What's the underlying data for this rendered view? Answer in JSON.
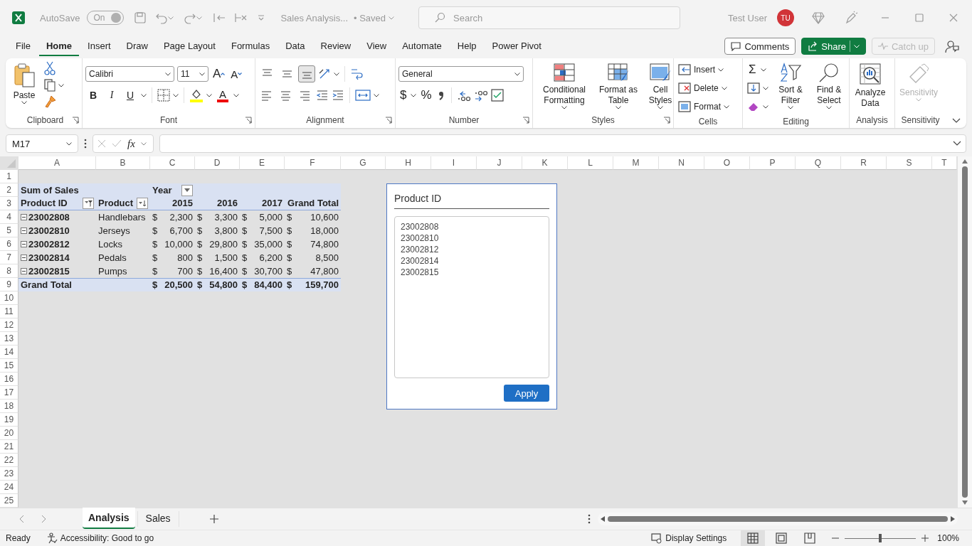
{
  "title_bar": {
    "autosave": {
      "label": "AutoSave",
      "state": "On",
      "on": true
    },
    "file_name": "Sales Analysis...",
    "save_status": "• Saved",
    "search": {
      "placeholder": "Search"
    },
    "user": {
      "name": "Test User",
      "initials": "TU"
    }
  },
  "menu": {
    "tabs": [
      {
        "label": "File",
        "selected": false
      },
      {
        "label": "Home",
        "selected": true
      },
      {
        "label": "Insert",
        "selected": false
      },
      {
        "label": "Draw",
        "selected": false
      },
      {
        "label": "Page Layout",
        "selected": false
      },
      {
        "label": "Formulas",
        "selected": false
      },
      {
        "label": "Data",
        "selected": false
      },
      {
        "label": "Review",
        "selected": false
      },
      {
        "label": "View",
        "selected": false
      },
      {
        "label": "Automate",
        "selected": false
      },
      {
        "label": "Help",
        "selected": false
      },
      {
        "label": "Power Pivot",
        "selected": false
      }
    ],
    "actions": [
      {
        "kind": "comments",
        "label": "Comments",
        "disabled": false
      },
      {
        "kind": "share",
        "label": "Share",
        "disabled": false
      },
      {
        "kind": "catchup",
        "label": "Catch up",
        "disabled": true
      }
    ]
  },
  "ribbon": {
    "clipboard": {
      "label": "Clipboard",
      "paste": "Paste"
    },
    "font": {
      "label": "Font",
      "font_name": "Calibri",
      "font_size": "11",
      "grow": "A",
      "shrink": "A",
      "styles": [
        "B",
        "I",
        "U"
      ],
      "font_color_letter": "A"
    },
    "alignment": {
      "label": "Alignment",
      "vertical": [
        {
          "selected": false
        },
        {
          "selected": false
        },
        {
          "selected": true
        }
      ]
    },
    "number": {
      "label": "Number",
      "format": "General",
      "currency": "$",
      "percent": "%"
    },
    "styles": {
      "label": "Styles",
      "buttons": [
        "Conditional Formatting",
        "Format as Table",
        "Cell Styles"
      ]
    },
    "cells": {
      "label": "Cells",
      "buttons": [
        "Insert",
        "Delete",
        "Format"
      ]
    },
    "editing": {
      "label": "Editing",
      "autosum": "Σ",
      "buttons": [
        "Sort & Filter",
        "Find & Select"
      ]
    },
    "analysis": {
      "label": "Analysis",
      "button": "Analyze Data"
    },
    "sensitivity": {
      "label": "Sensitivity",
      "button": "Sensitivity",
      "disabled": true
    }
  },
  "formula_bar": {
    "name_box": "M17",
    "fx": "fx"
  },
  "sheet": {
    "columns": [
      "A",
      "B",
      "C",
      "D",
      "E",
      "F",
      "G",
      "H",
      "I",
      "J",
      "K",
      "L",
      "M",
      "N",
      "O",
      "P",
      "Q",
      "R",
      "S",
      "T"
    ],
    "rows": [
      "1",
      "2",
      "3",
      "4",
      "5",
      "6",
      "7",
      "8",
      "9",
      "10",
      "11",
      "12",
      "13",
      "14",
      "15",
      "16",
      "17",
      "18",
      "19",
      "20",
      "21",
      "22",
      "23",
      "24",
      "25"
    ]
  },
  "pivot": {
    "value_label": "Sum of Sales",
    "column_field": "Year",
    "row_fields": [
      {
        "label": "Product ID",
        "filtered": true,
        "sorted": false
      },
      {
        "label": "Product",
        "filtered": false,
        "sorted": true
      }
    ],
    "column_items": [
      "2015",
      "2016",
      "2017"
    ],
    "total_column": "Grand Total",
    "rows": [
      {
        "id": "23002808",
        "expanded": true,
        "product": "Handlebars",
        "values": [
          [
            "$",
            "2,300"
          ],
          [
            "$",
            "3,300"
          ],
          [
            "$",
            "5,000"
          ],
          [
            "$",
            "10,600"
          ]
        ]
      },
      {
        "id": "23002810",
        "expanded": true,
        "product": "Jerseys",
        "values": [
          [
            "$",
            "6,700"
          ],
          [
            "$",
            "3,800"
          ],
          [
            "$",
            "7,500"
          ],
          [
            "$",
            "18,000"
          ]
        ]
      },
      {
        "id": "23002812",
        "expanded": true,
        "product": "Locks",
        "values": [
          [
            "$",
            "10,000"
          ],
          [
            "$",
            "29,800"
          ],
          [
            "$",
            "35,000"
          ],
          [
            "$",
            "74,800"
          ]
        ]
      },
      {
        "id": "23002814",
        "expanded": true,
        "product": "Pedals",
        "values": [
          [
            "$",
            "800"
          ],
          [
            "$",
            "1,500"
          ],
          [
            "$",
            "6,200"
          ],
          [
            "$",
            "8,500"
          ]
        ]
      },
      {
        "id": "23002815",
        "expanded": true,
        "product": "Pumps",
        "values": [
          [
            "$",
            "700"
          ],
          [
            "$",
            "16,400"
          ],
          [
            "$",
            "30,700"
          ],
          [
            "$",
            "47,800"
          ]
        ]
      }
    ],
    "grand_total": {
      "label": "Grand Total",
      "values": [
        [
          "$",
          "20,500"
        ],
        [
          "$",
          "54,800"
        ],
        [
          "$",
          "84,400"
        ],
        [
          "$",
          "159,700"
        ]
      ]
    }
  },
  "slicer": {
    "title": "Product ID",
    "items": [
      {
        "label": "23002808",
        "selected": false
      },
      {
        "label": "23002810",
        "selected": false
      },
      {
        "label": "23002812",
        "selected": false
      },
      {
        "label": "23002814",
        "selected": false
      },
      {
        "label": "23002815",
        "selected": false
      }
    ],
    "apply": "Apply"
  },
  "sheet_tabs": [
    {
      "label": "Analysis",
      "selected": true
    },
    {
      "label": "Sales",
      "selected": false
    }
  ],
  "status_bar": {
    "status": "Ready",
    "accessibility": "Accessibility: Good to go",
    "display_settings": "Display Settings",
    "views": [
      {
        "selected": true
      },
      {
        "selected": false
      },
      {
        "selected": false
      }
    ],
    "zoom": {
      "level": 0.5,
      "reading": "100%"
    }
  }
}
